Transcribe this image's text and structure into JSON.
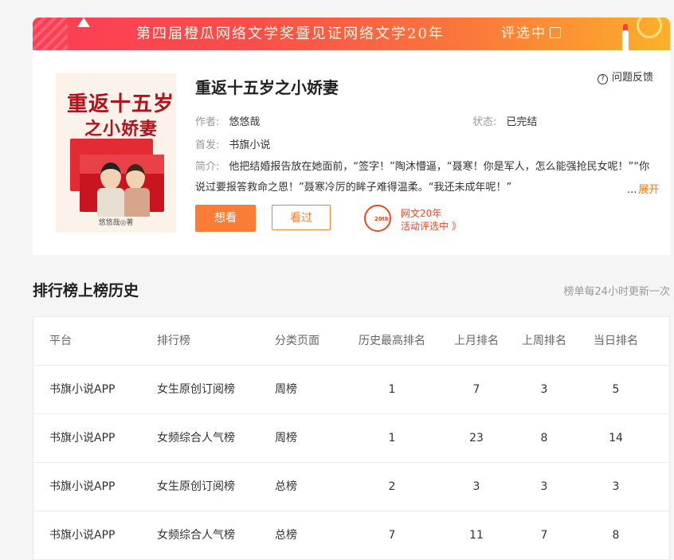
{
  "banner": {
    "text": "第四届橙瓜网络文学奖暨见证网络文学20年",
    "vote_label": "评选中"
  },
  "book": {
    "title": "重返十五岁之小娇妻",
    "feedback_label": "问题反馈",
    "cover": {
      "title_line1": "重返十五岁",
      "title_line2": "之小娇妻",
      "author": "悠悠哉◎著"
    },
    "author_key": "作者:",
    "author": "悠悠哉",
    "status_key": "状态:",
    "status": "已完结",
    "first_pub_key": "首发:",
    "first_pub": "书旗小说",
    "intro_key": "简介:",
    "intro": "他把结婚报告放在她面前，“签字！”陶沐懵逼，“聂寒！你是军人，怎么能强抢民女呢！”“你说过要报答救命之恩！”聂寒冷厉的眸子难得温柔。“我还未成年呢！”",
    "expand_dots": "...",
    "expand_label": "展开",
    "want_label": "想看",
    "read_label": "看过",
    "promo": {
      "logo_text": "20th",
      "line1": "网文20年",
      "line2": "活动评选中 》"
    }
  },
  "ranking": {
    "title": "排行榜上榜历史",
    "note": "榜单每24小时更新一次",
    "headers": [
      "平台",
      "排行榜",
      "分类页面",
      "历史最高排名",
      "上月排名",
      "上周排名",
      "当日排名"
    ],
    "rows": [
      [
        "书旗小说APP",
        "女生原创订阅榜",
        "周榜",
        "1",
        "7",
        "3",
        "5"
      ],
      [
        "书旗小说APP",
        "女频综合人气榜",
        "周榜",
        "1",
        "23",
        "8",
        "14"
      ],
      [
        "书旗小说APP",
        "女生原创订阅榜",
        "总榜",
        "2",
        "3",
        "3",
        "3"
      ],
      [
        "书旗小说APP",
        "女频综合人气榜",
        "总榜",
        "7",
        "11",
        "7",
        "8"
      ]
    ]
  }
}
